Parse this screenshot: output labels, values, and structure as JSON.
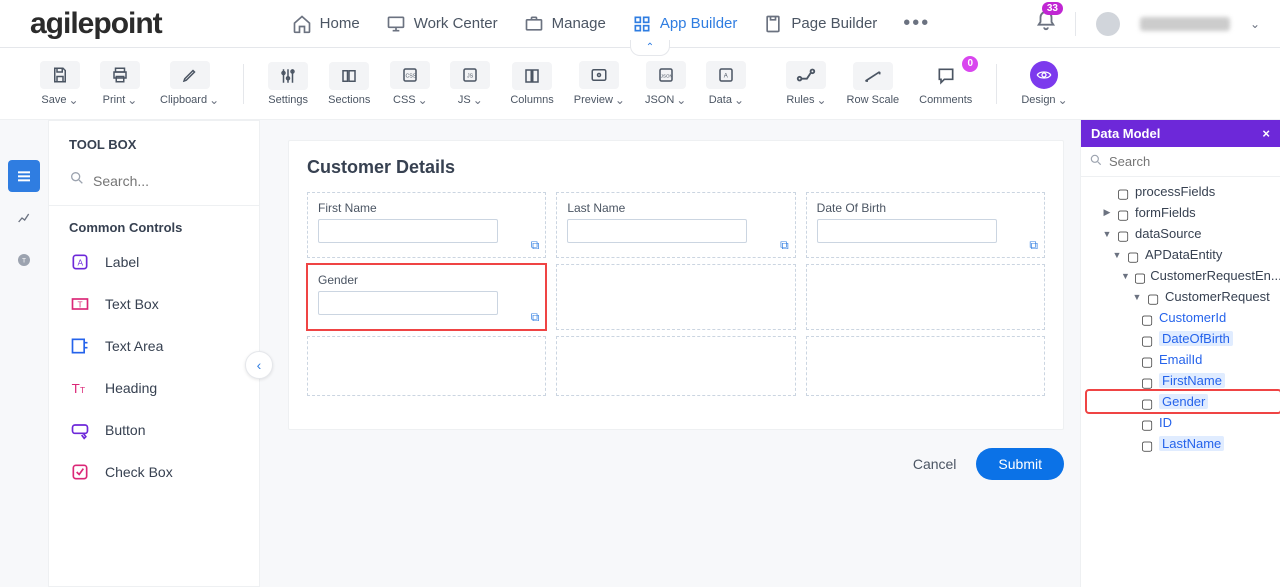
{
  "brand": "agilepoint",
  "nav": {
    "home": "Home",
    "work_center": "Work Center",
    "manage": "Manage",
    "app_builder": "App Builder",
    "page_builder": "Page Builder"
  },
  "notifications_count": "33",
  "toolbar": {
    "save": "Save",
    "print": "Print",
    "clipboard": "Clipboard",
    "settings": "Settings",
    "sections": "Sections",
    "css": "CSS",
    "js": "JS",
    "columns": "Columns",
    "preview": "Preview",
    "json": "JSON",
    "data": "Data",
    "rules": "Rules",
    "row_scale": "Row Scale",
    "comments": "Comments",
    "comments_count": "0",
    "design": "Design"
  },
  "toolbox": {
    "title": "TOOL BOX",
    "search_placeholder": "Search...",
    "common_controls": "Common Controls",
    "controls": {
      "label": "Label",
      "text_box": "Text Box",
      "text_area": "Text Area",
      "heading": "Heading",
      "button": "Button",
      "check_box": "Check Box"
    }
  },
  "canvas": {
    "title": "Customer Details",
    "fields": {
      "first_name": "First Name",
      "last_name": "Last Name",
      "dob": "Date Of Birth",
      "gender": "Gender"
    },
    "cancel": "Cancel",
    "submit": "Submit"
  },
  "data_model": {
    "title": "Data Model",
    "search_placeholder": "Search",
    "processFields": "processFields",
    "formFields": "formFields",
    "dataSource": "dataSource",
    "APDataEntity": "APDataEntity",
    "CustomerRequestEn": "CustomerRequestEn...",
    "CustomerRequest": "CustomerRequest",
    "CustomerId": "CustomerId",
    "DateOfBirth": "DateOfBirth",
    "EmailId": "EmailId",
    "FirstName": "FirstName",
    "Gender": "Gender",
    "ID": "ID",
    "LastName": "LastName"
  }
}
